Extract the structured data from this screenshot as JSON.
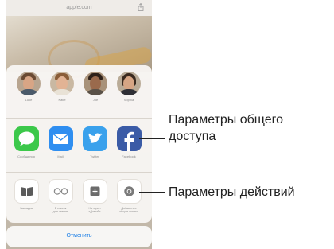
{
  "phone": {
    "title": "apple.com"
  },
  "sheet": {
    "people": [
      {
        "name": "Luke"
      },
      {
        "name": "Katie"
      },
      {
        "name": "Joe"
      },
      {
        "name": "Sophia"
      }
    ],
    "apps": [
      {
        "label": "Сообщения",
        "icon": "messages-icon",
        "color": "#3cc84a"
      },
      {
        "label": "Mail",
        "icon": "mail-icon",
        "color": "#2f8ef0"
      },
      {
        "label": "Twitter",
        "icon": "twitter-icon",
        "color": "#3aa1ec"
      },
      {
        "label": "Facebook",
        "icon": "facebook-icon",
        "color": "#3b5ba6"
      }
    ],
    "actions": [
      {
        "label_1": "Закладка",
        "label_2": "",
        "icon": "book-icon"
      },
      {
        "label_1": "В список",
        "label_2": "для чтения",
        "icon": "glasses-icon"
      },
      {
        "label_1": "На экран",
        "label_2": "«Домой»",
        "icon": "plus-square-icon"
      },
      {
        "label_1": "Добавить в",
        "label_2": "общие ссылки",
        "icon": "at-icon"
      }
    ],
    "cancel_label": "Отменить"
  },
  "callouts": {
    "sharing_line_1": "Параметры общего",
    "sharing_line_2": "доступа",
    "actions": "Параметры действий"
  }
}
